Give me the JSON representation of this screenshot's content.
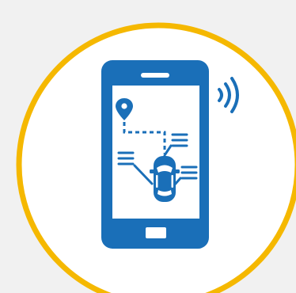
{
  "colors": {
    "background": "#f1f1f1",
    "circle_fill": "#ffffff",
    "circle_ring": "#f5b800",
    "phone_blue": "#1a6fb8",
    "screen_white": "#ffffff"
  },
  "icons": {
    "badge": "connected-car-app-icon",
    "phone": "smartphone-icon",
    "signal": "wireless-signal-icon",
    "pin": "location-pin-icon",
    "car": "car-top-view-icon"
  }
}
